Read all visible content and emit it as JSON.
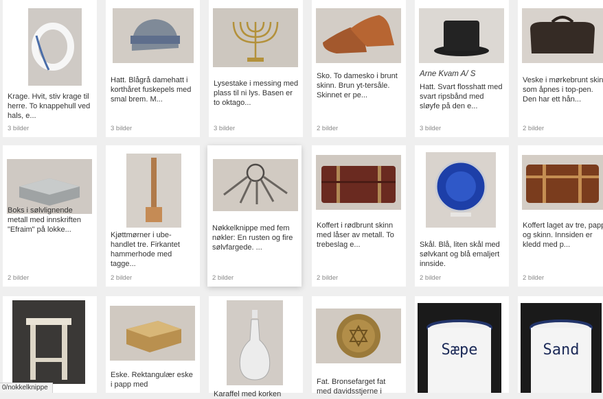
{
  "items": [
    {
      "desc": "Krage. Hvit, stiv krage til herre. To knappehull ved hals, e...",
      "count": "3 bilder",
      "icon": "collar"
    },
    {
      "desc": "Hatt. Blågrå damehatt i korthåret fuskepels med smal brem. M...",
      "count": "3 bilder",
      "icon": "ladies-hat"
    },
    {
      "desc": "Lysestake i messing med plass til ni lys. Basen er to oktago...",
      "count": "3 bilder",
      "icon": "menorah"
    },
    {
      "desc": "Sko. To damesko i brunt skinn. Brun yt-tersåle. Skinnet er pe...",
      "count": "2 bilder",
      "icon": "shoes"
    },
    {
      "artist": "Arne Kvam A/ S",
      "desc": "Hatt. Svart flosshatt med svart ripsbånd med sløyfe på den e...",
      "count": "3 bilder",
      "icon": "top-hat"
    },
    {
      "desc": "Veske i mørkebrunt skinn som åpnes i top-pen. Den har ett hån...",
      "count": "2 bilder",
      "icon": "doctor-bag"
    },
    {
      "desc": "Boks i sølvlignende metall med innskriften \"Efraim\" på lokke...",
      "count": "2 bilder",
      "icon": "silver-box"
    },
    {
      "desc": "Kjøttmørner i ube-handlet tre. Firkantet hammerhode med tagge...",
      "count": "2 bilder",
      "icon": "mallet"
    },
    {
      "desc": "Nøkkelknippe med fem nøkler: En rusten og fire sølvfargede. ...",
      "count": "2 bilder",
      "icon": "keys"
    },
    {
      "desc": "Koffert i rødbrunt skinn med låser av metall. To trebeslag e...",
      "count": "2 bilder",
      "icon": "suitcase"
    },
    {
      "desc": "Skål. Blå, liten skål med sølvkant og blå emaljert innside.",
      "count": "2 bilder",
      "icon": "blue-bowl"
    },
    {
      "desc": "Koffert laget av tre, papp og skinn. Innsiden er kledd med p...",
      "count": "2 bilder",
      "icon": "trunk"
    },
    {
      "desc": "",
      "count": "",
      "icon": "stool"
    },
    {
      "desc": "Eske. Rektangulær eske i papp med",
      "count": "",
      "icon": "cardboard-box"
    },
    {
      "desc": "Karaffel med korken",
      "count": "",
      "icon": "carafe"
    },
    {
      "desc": "Fat. Bronsefarget fat med davidsstjerne i",
      "count": "",
      "icon": "bronze-plate"
    },
    {
      "desc": "",
      "count": "",
      "icon": "saepe-jar",
      "jar_label": "Sæpe"
    },
    {
      "desc": "",
      "count": "",
      "icon": "sand-jar",
      "jar_label": "Sand"
    }
  ],
  "status_url": "0/nokkelknippe"
}
